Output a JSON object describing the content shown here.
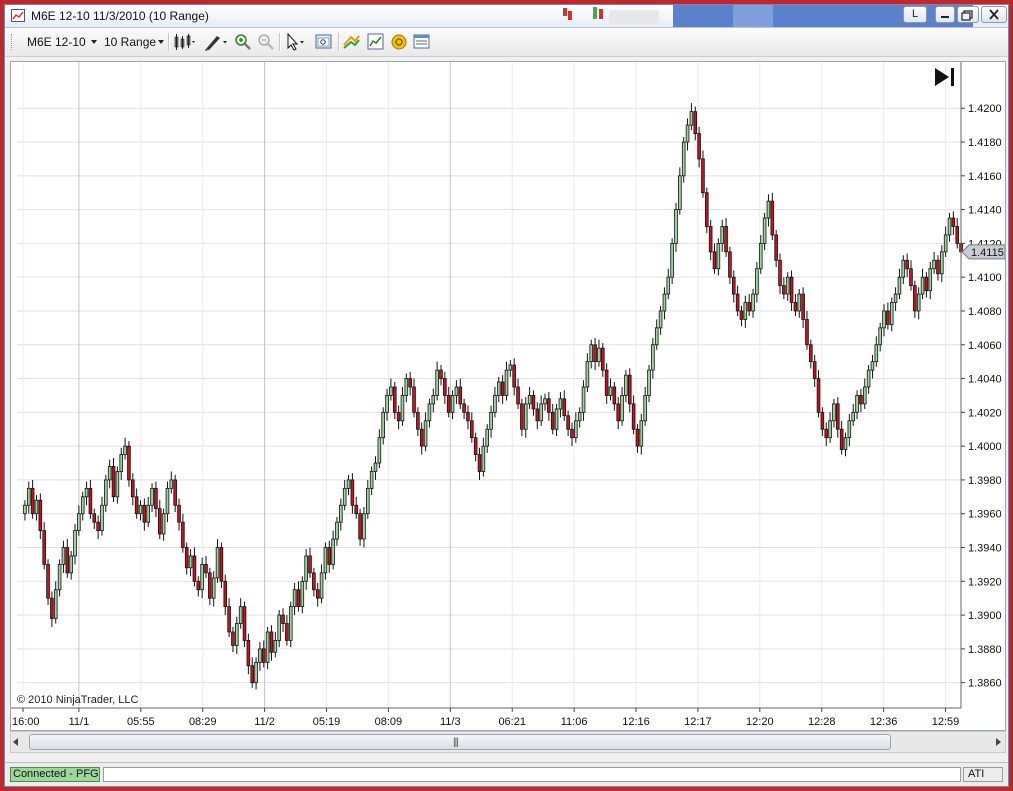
{
  "window": {
    "title": "M6E 12-10  11/3/2010 (10 Range)",
    "title_button": "L"
  },
  "toolbar": {
    "instrument": "M6E 12-10",
    "period": "10 Range"
  },
  "icons": {
    "candlestick": "candlestick-style-icon",
    "pencil": "drawing-tools-icon",
    "zoom_in": "zoom-in-icon",
    "zoom_out": "zoom-out-icon",
    "cursor": "pointer-icon",
    "data_box": "data-box-icon",
    "strategies": "strategies-icon",
    "indicators": "indicators-icon",
    "properties": "properties-icon",
    "list": "instrument-list-icon",
    "scroll_end": "scroll-to-end-icon"
  },
  "status": {
    "connection": "Connected - PFG",
    "account": "ATI"
  },
  "colors": {
    "up": "#9fd59f",
    "down": "#cc1122",
    "grid": "#e2e2e2",
    "connected": "#9bd89b"
  },
  "chart_data": {
    "type": "candlestick",
    "copyright": "© 2010 NinjaTrader, LLC",
    "ylim": [
      1.3845,
      1.4225
    ],
    "y_ticks": [
      1.386,
      1.388,
      1.39,
      1.392,
      1.394,
      1.396,
      1.398,
      1.4,
      1.402,
      1.404,
      1.406,
      1.408,
      1.41,
      1.412,
      1.414,
      1.416,
      1.418,
      1.42
    ],
    "x_ticks": [
      "16:00",
      "11/1",
      "05:55",
      "08:29",
      "11/2",
      "05:19",
      "08:09",
      "11/3",
      "06:21",
      "11:06",
      "12:16",
      "12:17",
      "12:20",
      "12:28",
      "12:36",
      "12:59"
    ],
    "last_price": "1.4115",
    "closes": [
      1.3965,
      1.3975,
      1.396,
      1.3968,
      1.395,
      1.393,
      1.391,
      1.3898,
      1.3915,
      1.393,
      1.394,
      1.3925,
      1.3935,
      1.395,
      1.396,
      1.397,
      1.3975,
      1.396,
      1.3955,
      1.395,
      1.3965,
      1.398,
      1.3988,
      1.397,
      1.3985,
      1.3995,
      1.4,
      1.398,
      1.397,
      1.396,
      1.3965,
      1.3955,
      1.3965,
      1.3975,
      1.3963,
      1.3948,
      1.396,
      1.3975,
      1.398,
      1.3965,
      1.3955,
      1.394,
      1.3928,
      1.3935,
      1.392,
      1.3915,
      1.393,
      1.3925,
      1.391,
      1.3922,
      1.394,
      1.392,
      1.3905,
      1.389,
      1.3882,
      1.3895,
      1.3905,
      1.3885,
      1.387,
      1.386,
      1.3872,
      1.388,
      1.3872,
      1.389,
      1.3878,
      1.3885,
      1.39,
      1.3895,
      1.3885,
      1.3905,
      1.3915,
      1.3905,
      1.392,
      1.3935,
      1.3925,
      1.3915,
      1.391,
      1.3925,
      1.394,
      1.393,
      1.3945,
      1.3955,
      1.3965,
      1.3975,
      1.398,
      1.3965,
      1.396,
      1.3945,
      1.396,
      1.3975,
      1.3985,
      1.399,
      1.4005,
      1.402,
      1.403,
      1.4035,
      1.402,
      1.4015,
      1.403,
      1.404,
      1.4035,
      1.402,
      1.401,
      1.4,
      1.4015,
      1.4025,
      1.403,
      1.4045,
      1.404,
      1.403,
      1.402,
      1.403,
      1.4035,
      1.4025,
      1.402,
      1.4015,
      1.4005,
      1.3995,
      1.3985,
      1.4,
      1.401,
      1.402,
      1.403,
      1.4038,
      1.403,
      1.4045,
      1.4048,
      1.4035,
      1.4025,
      1.401,
      1.4025,
      1.403,
      1.4022,
      1.4015,
      1.4025,
      1.4028,
      1.402,
      1.401,
      1.4022,
      1.4028,
      1.4018,
      1.401,
      1.4005,
      1.4015,
      1.402,
      1.4035,
      1.405,
      1.406,
      1.405,
      1.4058,
      1.4045,
      1.403,
      1.4035,
      1.4025,
      1.4015,
      1.403,
      1.4042,
      1.4025,
      1.401,
      1.4,
      1.4015,
      1.403,
      1.4045,
      1.406,
      1.407,
      1.408,
      1.409,
      1.41,
      1.412,
      1.414,
      1.416,
      1.418,
      1.419,
      1.4198,
      1.4185,
      1.417,
      1.415,
      1.413,
      1.4115,
      1.4105,
      1.412,
      1.413,
      1.4115,
      1.41,
      1.409,
      1.408,
      1.4075,
      1.4085,
      1.408,
      1.409,
      1.4105,
      1.412,
      1.4135,
      1.4145,
      1.4125,
      1.411,
      1.4095,
      1.409,
      1.41,
      1.4085,
      1.408,
      1.409,
      1.4075,
      1.406,
      1.405,
      1.404,
      1.402,
      1.401,
      1.4005,
      1.4015,
      1.4025,
      1.401,
      1.3998,
      1.4005,
      1.4015,
      1.402,
      1.403,
      1.4025,
      1.4035,
      1.4045,
      1.405,
      1.406,
      1.407,
      1.408,
      1.4072,
      1.4085,
      1.409,
      1.41,
      1.411,
      1.4105,
      1.4095,
      1.408,
      1.409,
      1.41,
      1.4092,
      1.4105,
      1.411,
      1.4102,
      1.4115,
      1.4125,
      1.4135,
      1.413,
      1.412,
      1.4115
    ]
  }
}
